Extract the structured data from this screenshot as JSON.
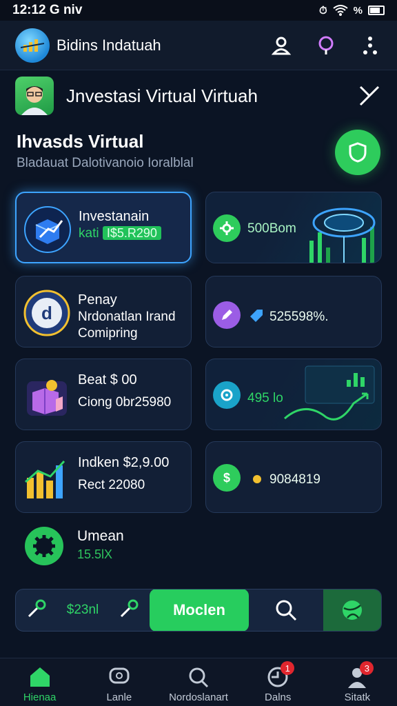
{
  "status_bar": {
    "time": "12:12",
    "carrier": "G niv",
    "battery": "%"
  },
  "app_bar": {
    "title": "Bidins Indatuah"
  },
  "header": {
    "title": "Jnvestasi Virtual Virtuah"
  },
  "section": {
    "title": "Ihvasds Virtual",
    "subtitle": "Bladauat Dalotivanoio Ioralblal"
  },
  "cards_left": [
    {
      "title": "Investanain",
      "line2_prefix": "kati",
      "line2_value": "I$5.R290"
    },
    {
      "title": "Penay",
      "line2": "Nrdonatlan Irand",
      "line3": "Comipring"
    },
    {
      "title": "Beat $ 00",
      "line2": "Ciong 0br25980"
    },
    {
      "title": "Indken $2,9.00",
      "line2": "Rect 22080"
    }
  ],
  "cards_right": [
    {
      "value": "500Bom"
    },
    {
      "value": "525598%."
    },
    {
      "value": "495 lo"
    },
    {
      "value": "9084819"
    }
  ],
  "umean": {
    "title": "Umean",
    "value": "15.5lX"
  },
  "action_bar": {
    "value": "$23nl",
    "primary_label": "Moclen"
  },
  "bottom_nav": [
    {
      "label": "Hienaa",
      "active": true
    },
    {
      "label": "Lanle"
    },
    {
      "label": "Nordoslanart"
    },
    {
      "label": "Dalns",
      "badge": "1"
    },
    {
      "label": "Sitatk",
      "badge": "3"
    }
  ],
  "colors": {
    "accent": "#2ecc5c",
    "glow": "#3da4ff",
    "background": "#0b1424"
  }
}
